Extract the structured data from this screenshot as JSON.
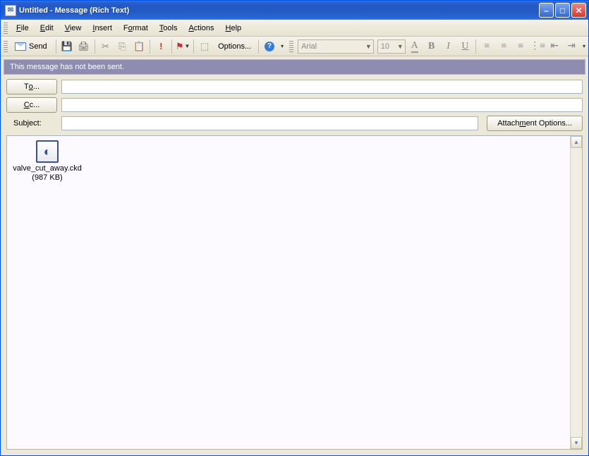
{
  "window": {
    "title": "Untitled - Message (Rich Text)"
  },
  "menu": {
    "file": "File",
    "edit": "Edit",
    "view": "View",
    "insert": "Insert",
    "format": "Format",
    "tools": "Tools",
    "actions": "Actions",
    "help": "Help"
  },
  "toolbar": {
    "send": "Send",
    "options": "Options...",
    "font_name": "Arial",
    "font_size": "10"
  },
  "info": {
    "not_sent": "This message has not been sent."
  },
  "address": {
    "to_btn": "To...",
    "cc_btn": "Cc...",
    "subject_lbl": "Subject:",
    "to_val": "",
    "cc_val": "",
    "subject_val": "",
    "attach_options": "Attachment Options..."
  },
  "attachment": {
    "name": "valve_cut_away.ckd",
    "size": "(987 KB)"
  }
}
